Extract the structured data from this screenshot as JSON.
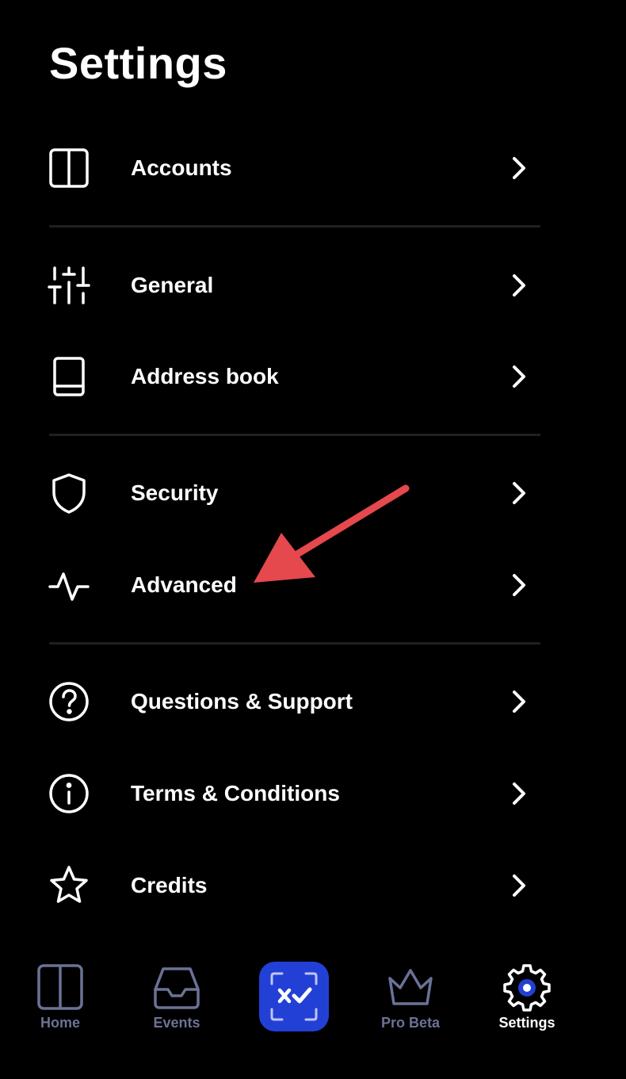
{
  "page": {
    "title": "Settings"
  },
  "menu": [
    {
      "label": "Accounts",
      "icon": "columns-icon"
    },
    {
      "label": "General",
      "icon": "sliders-icon"
    },
    {
      "label": "Address book",
      "icon": "book-icon"
    },
    {
      "label": "Security",
      "icon": "shield-icon"
    },
    {
      "label": "Advanced",
      "icon": "activity-icon"
    },
    {
      "label": "Questions & Support",
      "icon": "question-circle-icon"
    },
    {
      "label": "Terms & Conditions",
      "icon": "info-circle-icon"
    },
    {
      "label": "Credits",
      "icon": "star-icon"
    }
  ],
  "tabbar": {
    "tabs": [
      {
        "label": "Home",
        "icon": "columns-icon",
        "active": false
      },
      {
        "label": "Events",
        "icon": "inbox-icon",
        "active": false
      },
      {
        "label": "Pro Beta",
        "icon": "crown-icon",
        "active": false
      },
      {
        "label": "Settings",
        "icon": "gear-icon",
        "active": true
      }
    ],
    "center_action_icon": "scan-confirm-icon"
  },
  "colors": {
    "background": "#000000",
    "text": "#ffffff",
    "divider": "#1f1f24",
    "tab_inactive": "#6b7296",
    "accent": "#2340d6",
    "annotation": "#e5484d"
  }
}
